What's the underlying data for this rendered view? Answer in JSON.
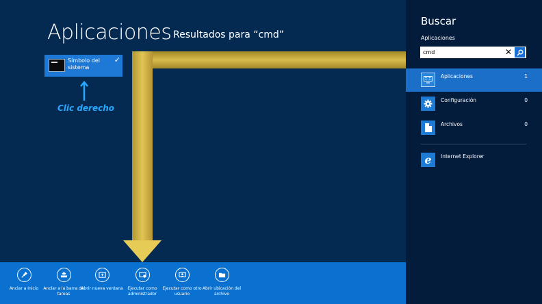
{
  "main": {
    "title": "Aplicaciones",
    "subtitle": "Resultados para “cmd”",
    "result_tile": {
      "label": "Símbolo del sistema",
      "icon": "command-prompt-icon",
      "checked": true
    },
    "annotation": "Clic derecho"
  },
  "appbar": {
    "items": [
      {
        "label": "Anclar a Inicio",
        "icon": "pin-icon"
      },
      {
        "label": "Anclar a la barra de tareas",
        "icon": "taskbar-pin-icon"
      },
      {
        "label": "Abrir nueva ventana",
        "icon": "new-window-icon"
      },
      {
        "label": "Ejecutar como administrador",
        "icon": "run-as-admin-icon"
      },
      {
        "label": "Ejecutar como otro usuario",
        "icon": "run-as-user-icon"
      },
      {
        "label": "Abrir ubicación del archivo",
        "icon": "folder-icon"
      }
    ]
  },
  "search_panel": {
    "title": "Buscar",
    "scope": "Aplicaciones",
    "query": "cmd",
    "categories": [
      {
        "label": "Aplicaciones",
        "count": "1",
        "icon": "apps-icon",
        "selected": true
      },
      {
        "label": "Configuración",
        "count": "0",
        "icon": "gear-icon",
        "selected": false
      },
      {
        "label": "Archivos",
        "count": "0",
        "icon": "file-icon",
        "selected": false
      }
    ],
    "apps": [
      {
        "label": "Internet Explorer",
        "icon": "internet-explorer-icon"
      }
    ]
  },
  "colors": {
    "background": "#052a52",
    "panel": "#041c3c",
    "accent": "#1b6fc9",
    "appbar": "#0b71d0",
    "annotation": "#28a8ff",
    "arrow": "#c9a83a"
  }
}
